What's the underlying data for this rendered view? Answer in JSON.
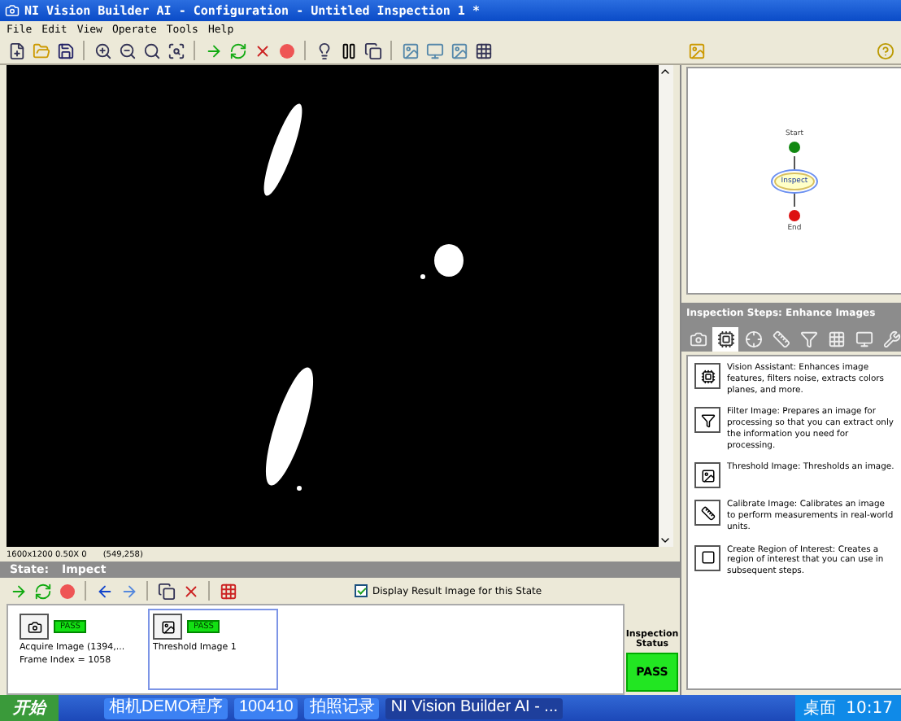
{
  "window": {
    "title": "NI Vision Builder AI - Configuration - Untitled Inspection 1 *"
  },
  "menu": [
    "File",
    "Edit",
    "View",
    "Operate",
    "Tools",
    "Help"
  ],
  "image_status": {
    "info": "1600x1200 0.50X 0",
    "coords": "(549,258)"
  },
  "diagram": {
    "nodes": [
      {
        "label": "Start",
        "kind": "start",
        "selected": false
      },
      {
        "label": "Inspect",
        "kind": "state",
        "selected": true
      },
      {
        "label": "End",
        "kind": "end",
        "selected": false
      }
    ]
  },
  "steps_panel": {
    "title": "Inspection Steps: Enhance Images",
    "tabs": [
      {
        "selected": false
      },
      {
        "selected": true
      },
      {
        "selected": false
      },
      {
        "selected": false
      },
      {
        "selected": false
      },
      {
        "selected": false
      },
      {
        "selected": false
      },
      {
        "selected": false
      }
    ],
    "items": [
      {
        "name": "Vision Assistant:",
        "description": "Enhances image features, filters noise, extracts colors planes, and more."
      },
      {
        "name": "Filter Image:",
        "description": "Prepares an image for processing so that you can extract only the information you need for processing."
      },
      {
        "name": "Threshold Image:",
        "description": "Thresholds an image."
      },
      {
        "name": "Calibrate Image:",
        "description": "Calibrates an image to perform measurements in real-world units."
      },
      {
        "name": "Create Region of Interest:",
        "description": "Creates a region of interest that you can use in subsequent steps."
      }
    ]
  },
  "state": {
    "label": "State:",
    "name": "Impect"
  },
  "display_result": {
    "label": "Display Result Image for this State",
    "checked": true
  },
  "steps": [
    {
      "name": "Acquire Image (1394,...",
      "result": "PASS",
      "detail": "Frame Index = 1058",
      "selected": false
    },
    {
      "name": "Threshold Image 1",
      "result": "PASS",
      "selected": true
    }
  ],
  "inspection_status": {
    "title": "Inspection Status",
    "result": "PASS"
  },
  "taskbar": {
    "start": "开始",
    "tasks": [
      {
        "label": "相机DEMO程序",
        "selected": false
      },
      {
        "label": "100410",
        "selected": false
      },
      {
        "label": "拍照记录",
        "selected": false
      },
      {
        "label": "NI Vision Builder AI - ...",
        "selected": true
      }
    ],
    "tray": [
      "桌面"
    ],
    "time": "10:17"
  }
}
